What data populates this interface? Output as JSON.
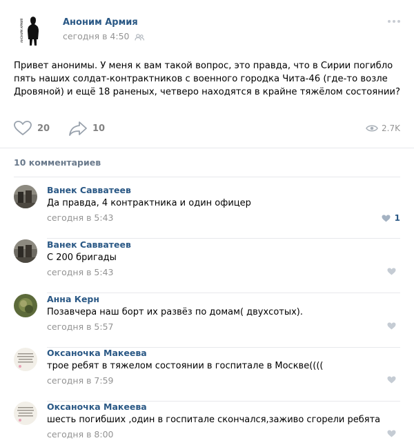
{
  "post": {
    "author": "Аноним Армия",
    "time": "сегодня в 4:50",
    "avatar_text": "АНОНИМ АРМИЯ",
    "text": "Привет анонимы. У меня к вам такой вопрос, это правда, что в Сирии погибло пять наших солдат-контрактников с военного городка Чита-46 (где-то возле Дровяной) и ещё 18 раненых, четверо находятся в крайне тяжёлом состоянии?",
    "likes": "20",
    "shares": "10",
    "views": "2.7K"
  },
  "comments_header": "10 комментариев",
  "comments": [
    {
      "author": "Ванек Савватеев",
      "text": "Да правда, 4 контрактника и один офицер",
      "time": "сегодня в 5:43",
      "likes": "1"
    },
    {
      "author": "Ванек Савватеев",
      "text": "С 200 бригады",
      "time": "сегодня в 5:43",
      "likes": ""
    },
    {
      "author": "Анна Керн",
      "text": "Позавчера наш борт их развёз по домам( двухсотых).",
      "time": "сегодня в 5:57",
      "likes": ""
    },
    {
      "author": "Оксаночка Макеева",
      "text": "трое ребят в тяжелом состоянии в госпитале в Москве((((",
      "time": "сегодня в 7:59",
      "likes": ""
    },
    {
      "author": "Оксаночка Макеева",
      "text": "шесть погибших ,один в госпитале скончался,заживо сгорели ребята",
      "time": "сегодня в 8:00",
      "likes": ""
    }
  ],
  "icons": {
    "audience": "people-icon",
    "more": "more-dots-icon",
    "like": "heart-icon",
    "share": "share-arrow-icon",
    "views": "eye-icon"
  },
  "colors": {
    "link": "#2a5885",
    "muted": "#939393",
    "icon": "#828282"
  }
}
